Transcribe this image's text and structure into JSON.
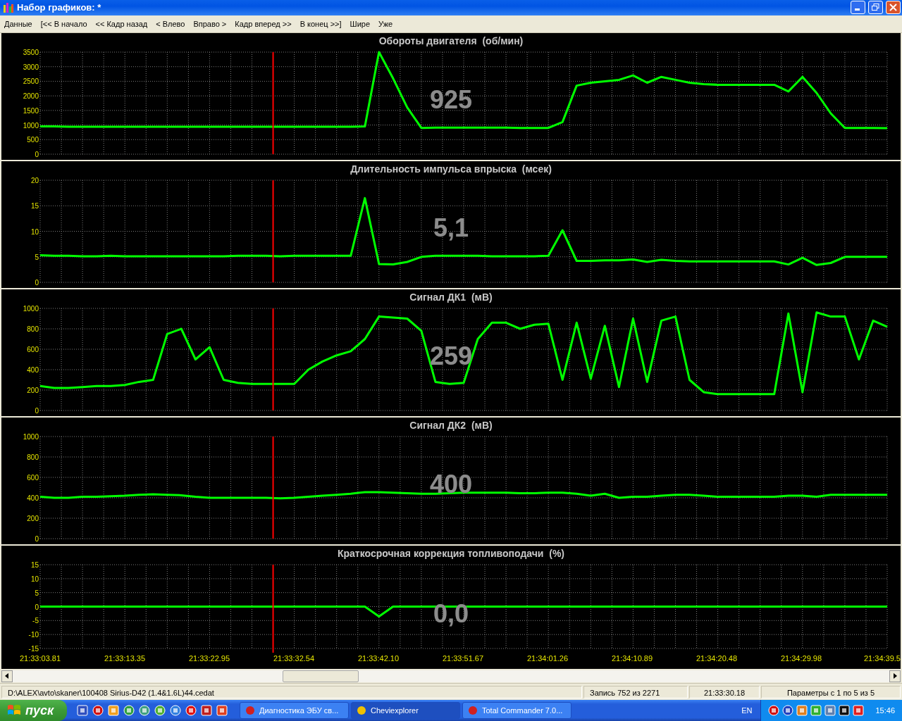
{
  "window": {
    "title": "Набор графиков: *"
  },
  "menu": [
    "Данные",
    "[<< В начало",
    "<< Кадр назад",
    "< Влево",
    "Вправо >",
    "Кадр вперед >>",
    "В конец >>]",
    "Шире",
    "Уже"
  ],
  "cursor": {
    "level": 0.275
  },
  "panels": [
    {
      "readout": "925",
      "chart_data": {
        "type": "line",
        "title": "Обороты двигателя  (об/мин)",
        "grid": true,
        "ylim": [
          0,
          3500
        ],
        "yticks": [
          0,
          500,
          1000,
          1500,
          2000,
          2500,
          3000,
          3500
        ],
        "series": [
          {
            "color": "#00ff00",
            "values": [
              950,
              950,
              940,
              940,
              940,
              940,
              940,
              940,
              940,
              940,
              940,
              940,
              940,
              940,
              940,
              940,
              940,
              940,
              940,
              940,
              940,
              940,
              940,
              950,
              3500,
              2600,
              1600,
              900,
              910,
              910,
              910,
              910,
              910,
              910,
              900,
              900,
              900,
              1100,
              2350,
              2450,
              2500,
              2550,
              2700,
              2450,
              2650,
              2550,
              2450,
              2400,
              2380,
              2380,
              2380,
              2380,
              2380,
              2150,
              2650,
              2100,
              1400,
              900,
              900,
              900,
              890
            ]
          }
        ]
      }
    },
    {
      "readout": "5,1",
      "chart_data": {
        "type": "line",
        "title": "Длительность импульса впрыска  (мсек)",
        "grid": true,
        "ylim": [
          0,
          20
        ],
        "yticks": [
          0,
          5,
          10,
          15,
          20
        ],
        "series": [
          {
            "color": "#00ff00",
            "values": [
              5.3,
              5.2,
              5.2,
              5.1,
              5.1,
              5.2,
              5.1,
              5.1,
              5.1,
              5.1,
              5.1,
              5.1,
              5.1,
              5.1,
              5.2,
              5.2,
              5.2,
              5.1,
              5.2,
              5.2,
              5.2,
              5.2,
              5.2,
              16.5,
              3.6,
              3.5,
              4,
              5,
              5.2,
              5.2,
              5.2,
              5.2,
              5.1,
              5.1,
              5.1,
              5.1,
              5.2,
              10.2,
              4.2,
              4.2,
              4.3,
              4.3,
              4.5,
              4,
              4.4,
              4.2,
              4.1,
              4.1,
              4.1,
              4.1,
              4.1,
              4.1,
              4.1,
              3.5,
              4.8,
              3.4,
              3.8,
              5,
              5,
              5,
              5
            ]
          }
        ]
      }
    },
    {
      "readout": "259",
      "chart_data": {
        "type": "line",
        "title": "Сигнал ДК1  (мВ)",
        "grid": true,
        "ylim": [
          0,
          1000
        ],
        "yticks": [
          0,
          200,
          400,
          600,
          800,
          1000
        ],
        "series": [
          {
            "color": "#00ff00",
            "values": [
              240,
              220,
              220,
              230,
              240,
              240,
              250,
              280,
              300,
              750,
              800,
              500,
              620,
              300,
              270,
              260,
              260,
              260,
              260,
              400,
              480,
              540,
              580,
              700,
              920,
              910,
              900,
              780,
              280,
              260,
              270,
              700,
              860,
              860,
              800,
              840,
              850,
              300,
              860,
              310,
              830,
              230,
              900,
              280,
              880,
              920,
              300,
              180,
              160,
              160,
              160,
              160,
              160,
              950,
              180,
              960,
              920,
              920,
              500,
              880,
              820
            ]
          }
        ]
      }
    },
    {
      "readout": "400",
      "chart_data": {
        "type": "line",
        "title": "Сигнал ДК2  (мВ)",
        "grid": true,
        "ylim": [
          0,
          1000
        ],
        "yticks": [
          0,
          200,
          400,
          600,
          800,
          1000
        ],
        "series": [
          {
            "color": "#00ff00",
            "values": [
              410,
              400,
              400,
              410,
              410,
              415,
              420,
              430,
              435,
              430,
              425,
              410,
              400,
              400,
              400,
              400,
              400,
              395,
              400,
              410,
              420,
              430,
              440,
              455,
              455,
              450,
              445,
              440,
              440,
              445,
              450,
              450,
              450,
              450,
              445,
              445,
              450,
              450,
              440,
              420,
              440,
              400,
              410,
              410,
              420,
              430,
              430,
              420,
              410,
              410,
              410,
              410,
              410,
              420,
              420,
              410,
              430,
              430,
              430,
              430,
              430
            ]
          }
        ]
      }
    },
    {
      "readout": "0,0",
      "chart_data": {
        "type": "line",
        "title": "Краткосрочная коррекция топливоподачи  (%)",
        "grid": true,
        "ylim": [
          -15,
          15
        ],
        "yticks": [
          -15,
          -10,
          -5,
          0,
          5,
          10,
          15
        ],
        "series": [
          {
            "color": "#00ff00",
            "values": [
              0,
              0,
              0,
              0,
              0,
              0,
              0,
              0,
              0,
              0,
              0,
              0,
              0,
              0,
              0,
              0,
              0,
              0,
              0,
              0,
              0,
              0,
              0,
              0,
              -3.5,
              0,
              0,
              0,
              0,
              0,
              0,
              0,
              0,
              0,
              0,
              0,
              0,
              0,
              0,
              0,
              0,
              0,
              0,
              0,
              0,
              0,
              0,
              0,
              0,
              0,
              0,
              0,
              0,
              0,
              0,
              0,
              0,
              0,
              0,
              0,
              0
            ]
          }
        ]
      }
    }
  ],
  "time_labels": [
    "21:33:03.81",
    "21:33:13.35",
    "21:33:22.95",
    "21:33:32.54",
    "21:33:42.10",
    "21:33:51.67",
    "21:34:01.26",
    "21:34:10.89",
    "21:34:20.48",
    "21:34:29.98",
    "21:34:39.5"
  ],
  "status_bar": {
    "path": "D:\\ALEX\\avto\\skaner\\100408 Sirius-D42 (1.4&1.6L)44.cedat",
    "record": "Запись 752 из 2271",
    "time": "21:33:30.18",
    "params": "Параметры с 1 по 5 из 5"
  },
  "taskbar": {
    "start": "пуск",
    "tasks": [
      {
        "label": "Диагностика ЭБУ св...",
        "selected": false
      },
      {
        "label": "Cheviexplorer",
        "selected": true
      },
      {
        "label": "Total Commander 7.0...",
        "selected": false
      }
    ],
    "language": "EN",
    "clock": "15:46"
  }
}
